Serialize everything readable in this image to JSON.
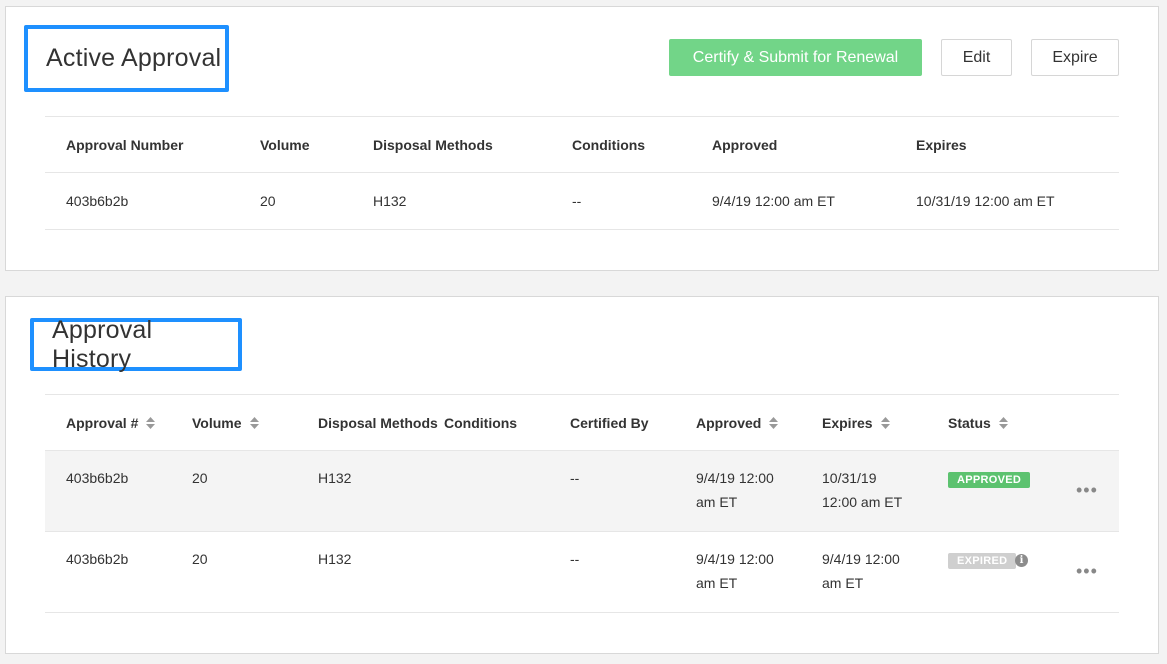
{
  "active": {
    "title": "Active Approval",
    "buttons": {
      "certify": "Certify & Submit for Renewal",
      "edit": "Edit",
      "expire": "Expire"
    },
    "columns": [
      "Approval Number",
      "Volume",
      "Disposal Methods",
      "Conditions",
      "Approved",
      "Expires"
    ],
    "row": {
      "approval_number": "403b6b2b",
      "volume": "20",
      "disposal_methods": "H132",
      "conditions": "--",
      "approved": "9/4/19 12:00 am ET",
      "expires": "10/31/19 12:00 am ET"
    }
  },
  "history": {
    "title": "Approval History",
    "columns": {
      "approval": "Approval #",
      "volume": "Volume",
      "disposal_methods": "Disposal Methods",
      "conditions": "Conditions",
      "certified_by": "Certified By",
      "approved": "Approved",
      "expires": "Expires",
      "status": "Status"
    },
    "rows": [
      {
        "approval": "403b6b2b",
        "volume": "20",
        "disposal_methods": "H132",
        "certified_by": "--",
        "approved_line1": "9/4/19 12:00",
        "approved_line2": "am ET",
        "expires_line1": "10/31/19",
        "expires_line2": "12:00 am ET",
        "status": "APPROVED"
      },
      {
        "approval": "403b6b2b",
        "volume": "20",
        "disposal_methods": "H132",
        "certified_by": "--",
        "approved_line1": "9/4/19 12:00",
        "approved_line2": "am ET",
        "expires_line1": "9/4/19 12:00",
        "expires_line2": "am ET",
        "status": "EXPIRED"
      }
    ],
    "info_icon_glyph": "i",
    "more_icon_glyph": "•••"
  },
  "colors": {
    "highlight_border": "#1e90ff",
    "primary_button": "#72d588",
    "approved_badge": "#5cc26f",
    "expired_badge": "#cfcfcf"
  }
}
